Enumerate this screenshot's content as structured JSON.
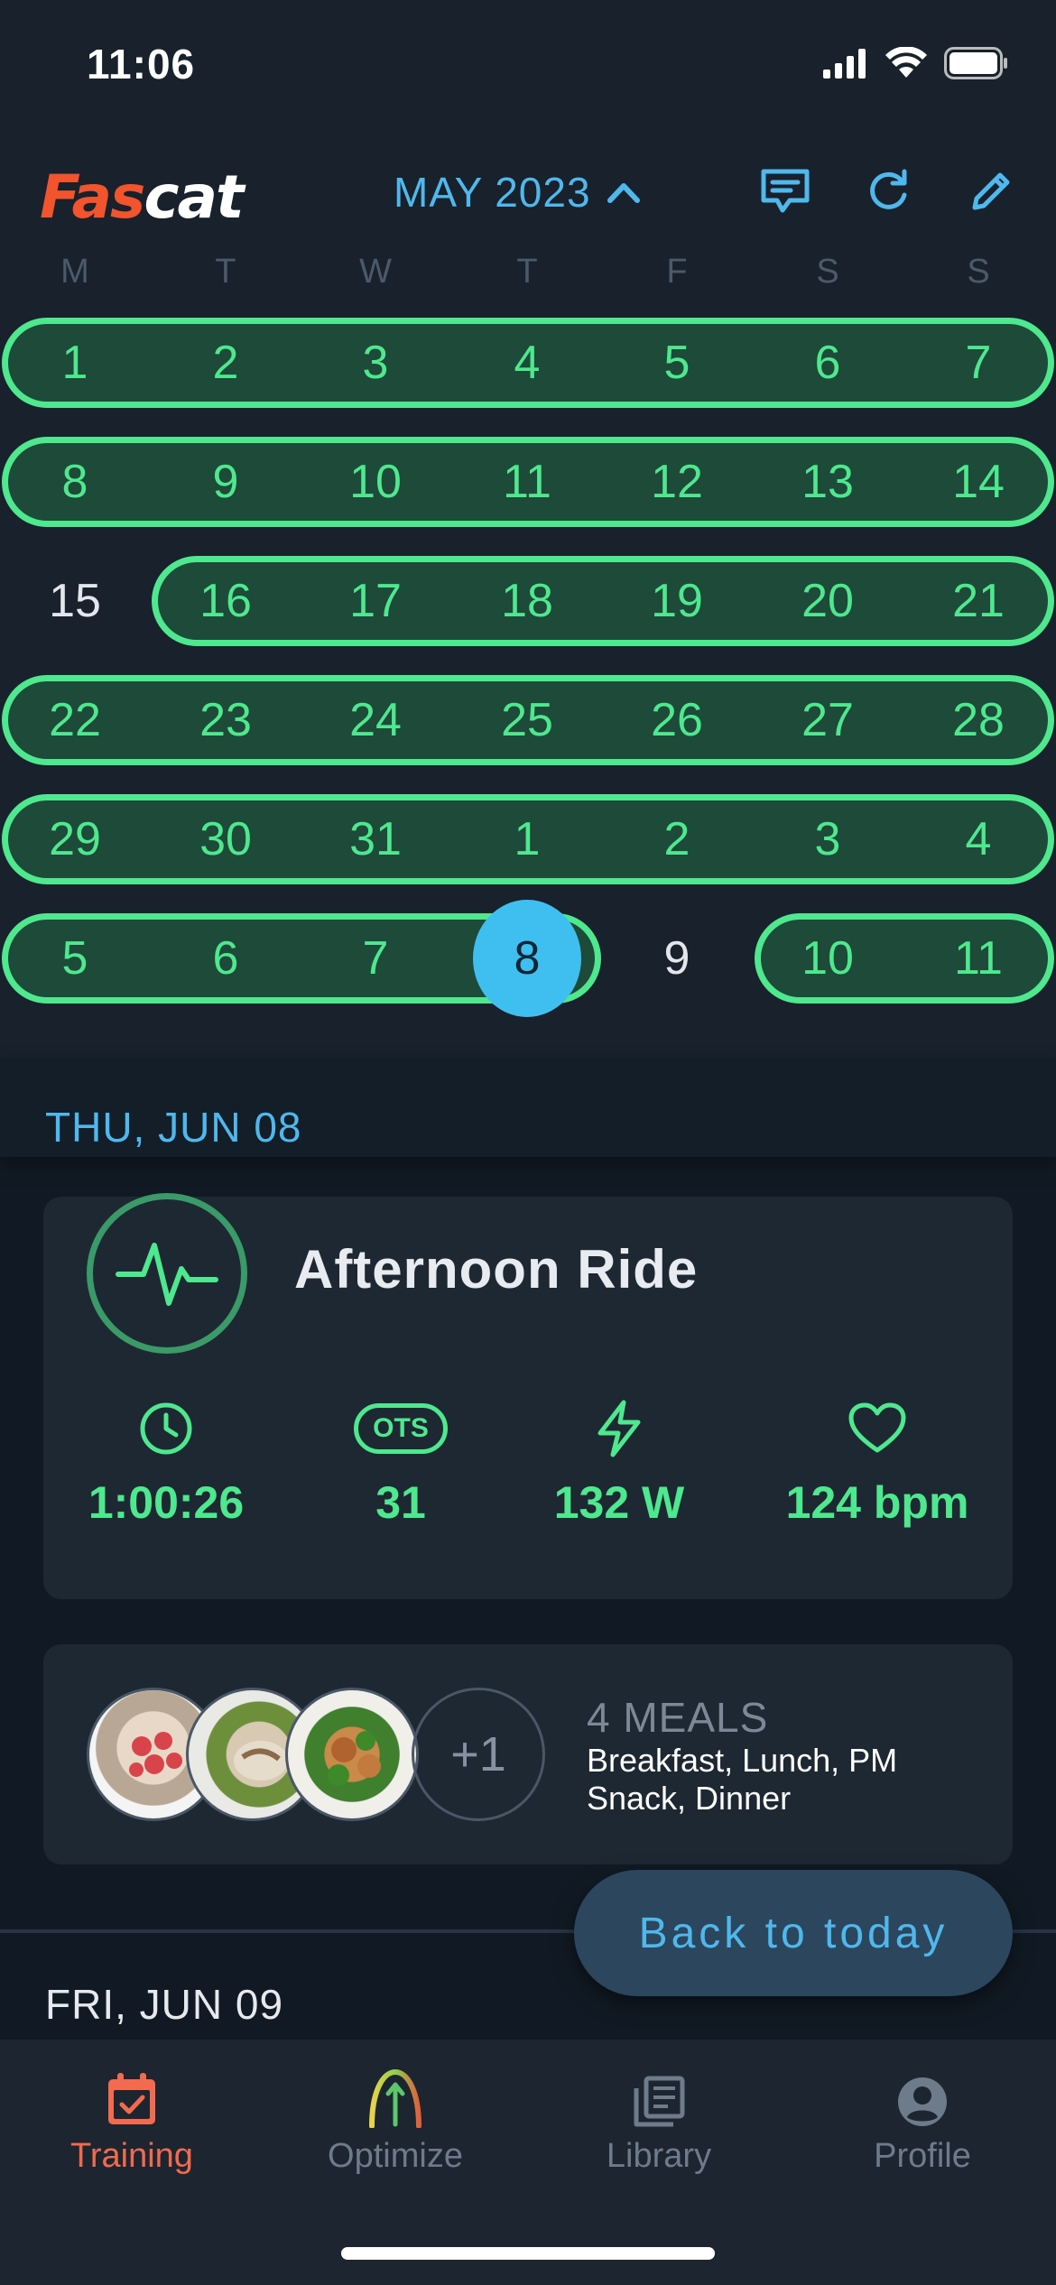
{
  "status_bar": {
    "time": "11:06"
  },
  "header": {
    "logo_part1": "Fas",
    "logo_part2": "cat",
    "month_label": "MAY 2023",
    "icons": [
      "chat-icon",
      "refresh-icon",
      "edit-icon"
    ]
  },
  "calendar": {
    "weekdays": [
      "M",
      "T",
      "W",
      "T",
      "F",
      "S",
      "S"
    ],
    "weeks": [
      [
        "1",
        "2",
        "3",
        "4",
        "5",
        "6",
        "7"
      ],
      [
        "8",
        "9",
        "10",
        "11",
        "12",
        "13",
        "14"
      ],
      [
        "15",
        "16",
        "17",
        "18",
        "19",
        "20",
        "21"
      ],
      [
        "22",
        "23",
        "24",
        "25",
        "26",
        "27",
        "28"
      ],
      [
        "29",
        "30",
        "31",
        "1",
        "2",
        "3",
        "4"
      ],
      [
        "5",
        "6",
        "7",
        "8",
        "9",
        "10",
        "11"
      ]
    ],
    "today": "8"
  },
  "day1": {
    "label": "THU, JUN 08",
    "activity": {
      "title": "Afternoon Ride",
      "icon": "activity-pulse-icon",
      "stats": [
        {
          "icon": "clock-icon",
          "value": "1:00:26"
        },
        {
          "icon": "ots-badge",
          "badge": "OTS",
          "value": "31"
        },
        {
          "icon": "lightning-icon",
          "value": "132 W"
        },
        {
          "icon": "heart-icon",
          "value": "124 bpm"
        }
      ]
    },
    "meals": {
      "count_label": "4 MEALS",
      "names": "Breakfast, Lunch, PM Snack, Dinner",
      "more_label": "+1"
    }
  },
  "day2": {
    "label": "FRI, JUN 09"
  },
  "back_to_today": "Back to today",
  "tabs": [
    {
      "label": "Training",
      "icon": "calendar-check-icon",
      "active": true
    },
    {
      "label": "Optimize",
      "icon": "optimize-arrow-icon",
      "active": false
    },
    {
      "label": "Library",
      "icon": "library-icon",
      "active": false
    },
    {
      "label": "Profile",
      "icon": "profile-icon",
      "active": false
    }
  ],
  "colors": {
    "background": "#18212c",
    "accent_green": "#4ee88e",
    "accent_blue": "#4fb8ec",
    "brand_orange": "#f2542d"
  }
}
